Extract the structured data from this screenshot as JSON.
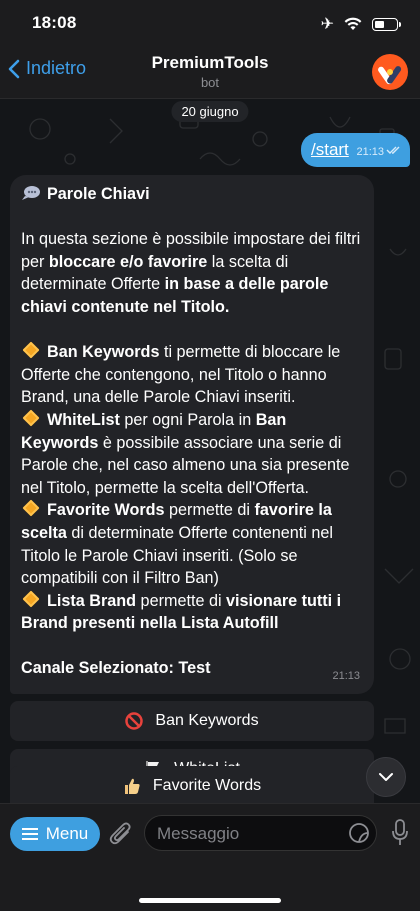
{
  "status": {
    "time": "18:08"
  },
  "header": {
    "back_label": "Indietro",
    "title": "PremiumTools",
    "subtitle": "bot"
  },
  "chat": {
    "date": "20 giugno",
    "outgoing": {
      "text": "/start",
      "time": "21:13"
    },
    "incoming": {
      "title": "Parole Chiavi",
      "intro_1": "In questa sezione è possibile impostare dei filtri per ",
      "intro_b1": "bloccare e/o favorire",
      "intro_2": " la scelta di determinate Offerte ",
      "intro_b2": "in base a delle parole chiavi contenute nel Titolo.",
      "ban_title": "Ban Keywords",
      "ban_text": " ti permette di bloccare le Offerte che contengono, nel Titolo o hanno Brand, una delle Parole Chiavi inseriti.",
      "wl_title": "WhiteList",
      "wl_text_1": " per ogni Parola in ",
      "wl_bold": "Ban Keywords",
      "wl_text_2": " è possibile associare una serie di Parole che, nel caso almeno una sia presente nel Titolo, permette la scelta dell'Offerta.",
      "fav_title": "Favorite Words",
      "fav_text_1": " permette di ",
      "fav_bold": "favorire la scelta",
      "fav_text_2": " di determinate Offerte contenenti nel Titolo le Parole Chiavi inseriti. (Solo se compatibili con il Filtro Ban)",
      "brand_title": "Lista Brand",
      "brand_text_1": " permette di ",
      "brand_bold": "visionare tutti i Brand presenti nella Lista Autofill",
      "channel": "Canale Selezionato: Test",
      "time": "21:13"
    },
    "buttons": [
      {
        "label": "Ban Keywords",
        "icon": "prohibited-icon"
      },
      {
        "label": "WhiteList",
        "icon": "white-flag-icon"
      },
      {
        "label": "Favorite Words",
        "icon": "thumbs-up-icon"
      }
    ]
  },
  "composer": {
    "menu_label": "Menu",
    "placeholder": "Messaggio"
  },
  "colors": {
    "accent": "#3e9fe0",
    "bubble_in": "#222327",
    "diamond": "#f5a623"
  }
}
